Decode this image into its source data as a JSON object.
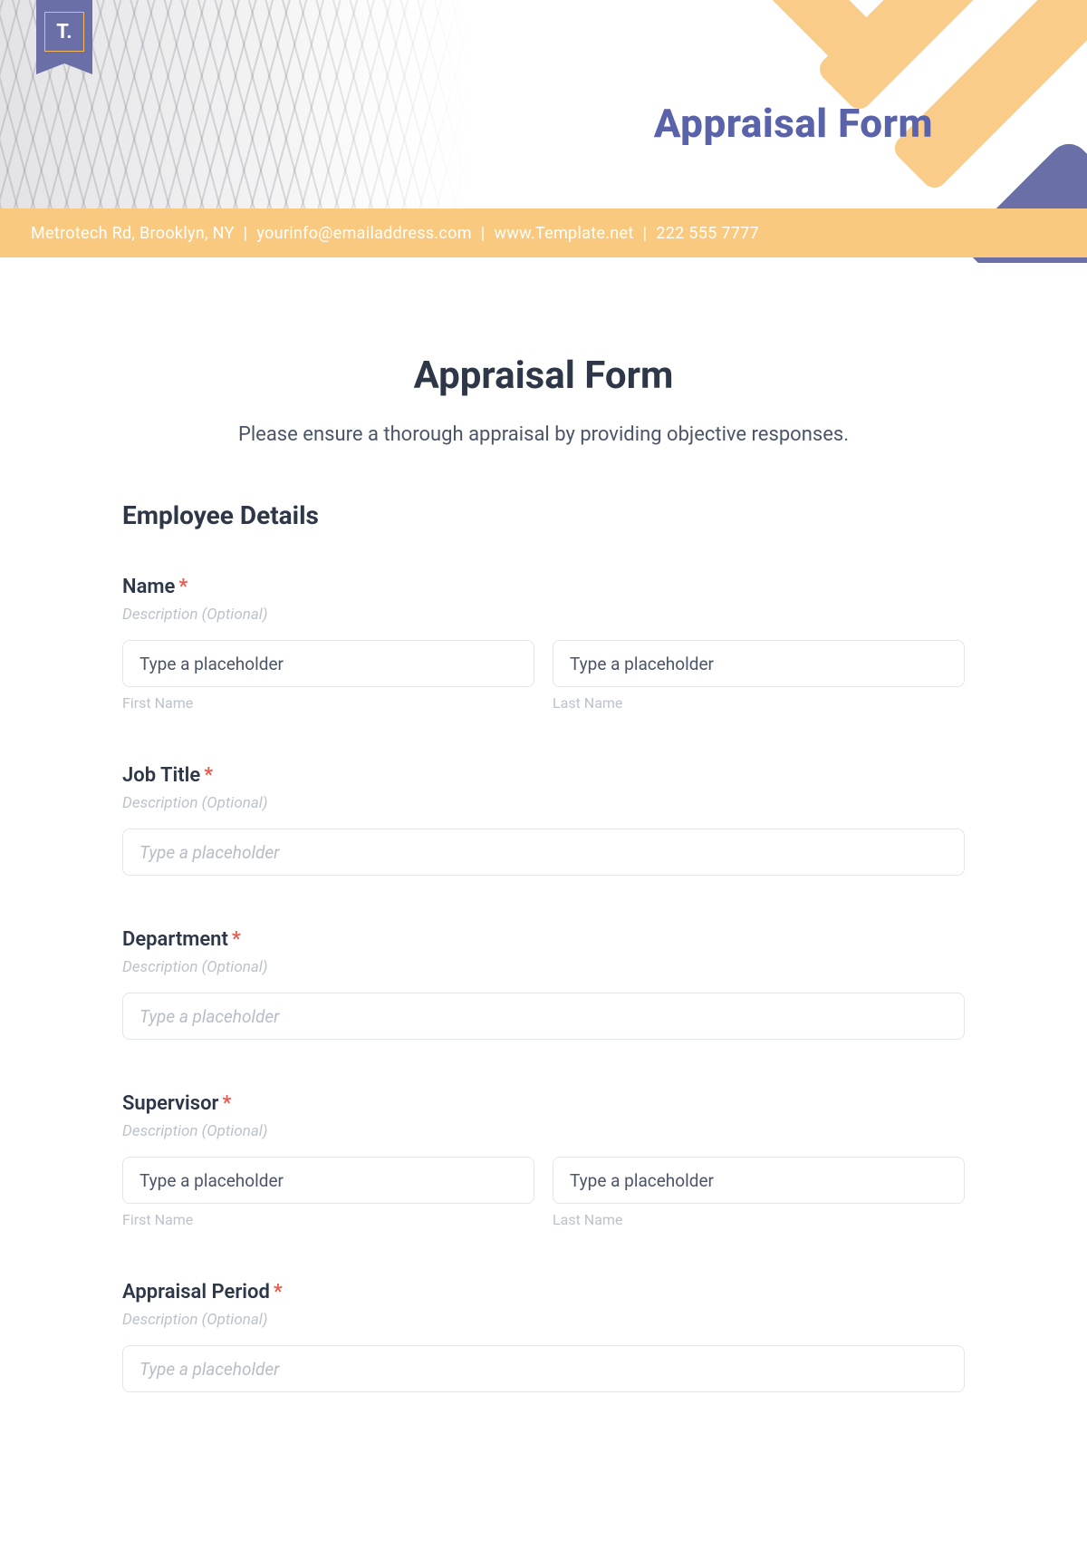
{
  "logo": {
    "text": "T."
  },
  "header": {
    "title": "Appraisal Form",
    "contact": {
      "address": "Metrotech Rd, Brooklyn, NY",
      "email": "yourinfo@emailaddress.com",
      "website": "www.Template.net",
      "phone": "222 555 7777"
    }
  },
  "form": {
    "title": "Appraisal Form",
    "subtitle": "Please ensure a thorough appraisal by providing objective responses.",
    "section_title": "Employee Details",
    "desc_placeholder": "Description (Optional)",
    "sublabels": {
      "first_name": "First Name",
      "last_name": "Last Name"
    },
    "placeholders": {
      "dark": "Type a placeholder",
      "light": "Type a placeholder"
    },
    "fields": {
      "name": {
        "label": "Name"
      },
      "job_title": {
        "label": "Job Title"
      },
      "department": {
        "label": "Department"
      },
      "supervisor": {
        "label": "Supervisor"
      },
      "appraisal_period": {
        "label": "Appraisal Period"
      }
    }
  }
}
